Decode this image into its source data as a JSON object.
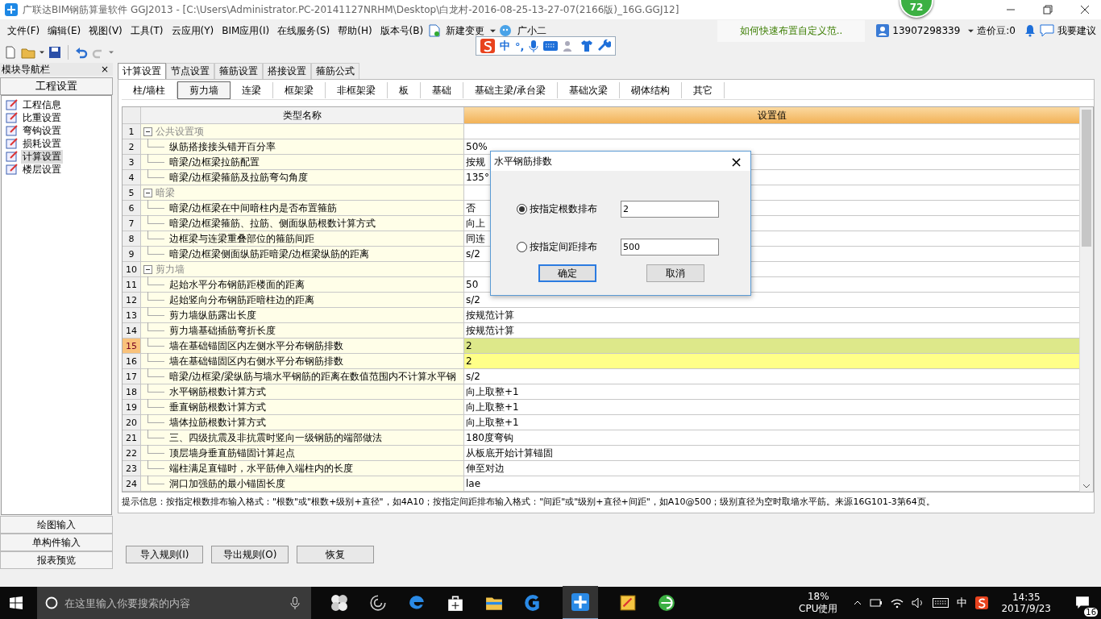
{
  "window": {
    "title": "广联达BIM钢筋算量软件 GGJ2013 - [C:\\Users\\Administrator.PC-20141127NRHM\\Desktop\\白龙村-2016-08-25-13-27-07(2166版)_16G.GGJ12]"
  },
  "float_badge": "72",
  "menu": [
    "文件(F)",
    "编辑(E)",
    "视图(V)",
    "工具(T)",
    "云应用(Y)",
    "BIM应用(I)",
    "在线服务(S)",
    "帮助(H)",
    "版本号(B)"
  ],
  "menu_extras": {
    "new_change": "新建变更",
    "assistant": "广小二"
  },
  "ime_toolbar": {
    "language": "中",
    "punctuation": "°,"
  },
  "help_link": "如何快速布置自定义范..",
  "account": {
    "phone": "13907298339",
    "beans": "造价豆:0",
    "suggest": "我要建议"
  },
  "nav": {
    "title": "模块导航栏",
    "close": "×",
    "section": "工程设置",
    "items": [
      {
        "label": "工程信息",
        "selected": false
      },
      {
        "label": "比重设置",
        "selected": false
      },
      {
        "label": "弯钩设置",
        "selected": false
      },
      {
        "label": "损耗设置",
        "selected": false
      },
      {
        "label": "计算设置",
        "selected": true
      },
      {
        "label": "楼层设置",
        "selected": false
      }
    ],
    "bottom": [
      "绘图输入",
      "单构件输入",
      "报表预览"
    ]
  },
  "tabs": [
    {
      "label": "计算设置",
      "selected": true
    },
    {
      "label": "节点设置",
      "selected": false
    },
    {
      "label": "箍筋设置",
      "selected": false
    },
    {
      "label": "搭接设置",
      "selected": false
    },
    {
      "label": "箍筋公式",
      "selected": false
    }
  ],
  "subtabs": [
    {
      "label": "柱/墙柱",
      "selected": false
    },
    {
      "label": "剪力墙",
      "selected": true
    },
    {
      "label": "连梁",
      "selected": false
    },
    {
      "label": "框架梁",
      "selected": false
    },
    {
      "label": "非框架梁",
      "selected": false
    },
    {
      "label": "板",
      "selected": false
    },
    {
      "label": "基础",
      "selected": false
    },
    {
      "label": "基础主梁/承台梁",
      "selected": false
    },
    {
      "label": "基础次梁",
      "selected": false
    },
    {
      "label": "砌体结构",
      "selected": false
    },
    {
      "label": "其它",
      "selected": false
    }
  ],
  "grid": {
    "columns": [
      "类型名称",
      "设置值"
    ],
    "rows": [
      {
        "num": "1",
        "name": "公共设置项",
        "expanded": true,
        "selected": false,
        "children": [
          {
            "num": "2",
            "name": "纵筋搭接接头错开百分率",
            "value": "50%",
            "selected": false,
            "marked": false
          },
          {
            "num": "3",
            "name": "暗梁/边框梁拉筋配置",
            "value": "按规",
            "selected": false,
            "marked": false
          },
          {
            "num": "4",
            "name": "暗梁/边框梁箍筋及拉筋弯勾角度",
            "value": "135°",
            "selected": false,
            "marked": false
          }
        ]
      },
      {
        "num": "5",
        "name": "暗梁",
        "expanded": true,
        "selected": false,
        "children": [
          {
            "num": "6",
            "name": "暗梁/边框梁在中间暗柱内是否布置箍筋",
            "value": "否",
            "selected": false,
            "marked": false
          },
          {
            "num": "7",
            "name": "暗梁/边框梁箍筋、拉筋、侧面纵筋根数计算方式",
            "value": "向上",
            "selected": false,
            "marked": false
          },
          {
            "num": "8",
            "name": "边框梁与连梁重叠部位的箍筋间距",
            "value": "同连",
            "selected": false,
            "marked": false
          },
          {
            "num": "9",
            "name": "暗梁/边框梁侧面纵筋距暗梁/边框梁纵筋的距离",
            "value": "s/2",
            "selected": false,
            "marked": false
          }
        ]
      },
      {
        "num": "10",
        "name": "剪力墙",
        "expanded": true,
        "selected": false,
        "children": [
          {
            "num": "11",
            "name": "起始水平分布钢筋距楼面的距离",
            "value": "50",
            "selected": false,
            "marked": false
          },
          {
            "num": "12",
            "name": "起始竖向分布钢筋距暗柱边的距离",
            "value": "s/2",
            "selected": false,
            "marked": false
          },
          {
            "num": "13",
            "name": "剪力墙纵筋露出长度",
            "value": "按规范计算",
            "selected": false,
            "marked": false
          },
          {
            "num": "14",
            "name": "剪力墙基础插筋弯折长度",
            "value": "按规范计算",
            "selected": false,
            "marked": false
          },
          {
            "num": "15",
            "name": "墙在基础锚固区内左侧水平分布钢筋排数",
            "value": "2",
            "selected": true,
            "marked": false
          },
          {
            "num": "16",
            "name": "墙在基础锚固区内右侧水平分布钢筋排数",
            "value": "2",
            "selected": false,
            "marked": true
          },
          {
            "num": "17",
            "name": "暗梁/边框梁/梁纵筋与墙水平钢筋的距离在数值范围内不计算水平钢",
            "value": "s/2",
            "selected": false,
            "marked": false
          },
          {
            "num": "18",
            "name": "水平钢筋根数计算方式",
            "value": "向上取整+1",
            "selected": false,
            "marked": false
          },
          {
            "num": "19",
            "name": "垂直钢筋根数计算方式",
            "value": "向上取整+1",
            "selected": false,
            "marked": false
          },
          {
            "num": "20",
            "name": "墙体拉筋根数计算方式",
            "value": "向上取整+1",
            "selected": false,
            "marked": false
          },
          {
            "num": "21",
            "name": "三、四级抗震及非抗震时竖向一级钢筋的端部做法",
            "value": "180度弯钩",
            "selected": false,
            "marked": false
          },
          {
            "num": "22",
            "name": "顶层墙身垂直筋锚固计算起点",
            "value": "从板底开始计算锚固",
            "selected": false,
            "marked": false
          },
          {
            "num": "23",
            "name": "端柱满足直锚时，水平筋伸入端柱内的长度",
            "value": "伸至对边",
            "selected": false,
            "marked": false
          },
          {
            "num": "24",
            "name": "洞口加强筋的最小锚固长度",
            "value": "lae",
            "selected": false,
            "marked": false
          }
        ]
      }
    ]
  },
  "hint": "提示信息：按指定根数排布输入格式：\"根数\"或\"根数+级别+直径\"，如4A10；按指定间距排布输入格式：\"间距\"或\"级别+直径+间距\"，如A10@500；级别直径为空时取墙水平筋。来源16G101-3第64页。",
  "buttons": [
    "导入规则(I)",
    "导出规则(O)",
    "恢复"
  ],
  "dialog": {
    "title": "水平钢筋排数",
    "close": "×",
    "options": [
      {
        "label": "按指定根数排布",
        "selected": true,
        "value": "2"
      },
      {
        "label": "按指定间距排布",
        "selected": false,
        "value": "500"
      }
    ],
    "buttons": [
      "确定",
      "取消"
    ]
  },
  "taskbar": {
    "search_placeholder": "在这里输入你要搜索的内容",
    "cpu_value": "18%",
    "cpu_label": "CPU使用",
    "ime": "中",
    "time": "14:35",
    "date": "2017/9/23",
    "notifications": "16"
  }
}
